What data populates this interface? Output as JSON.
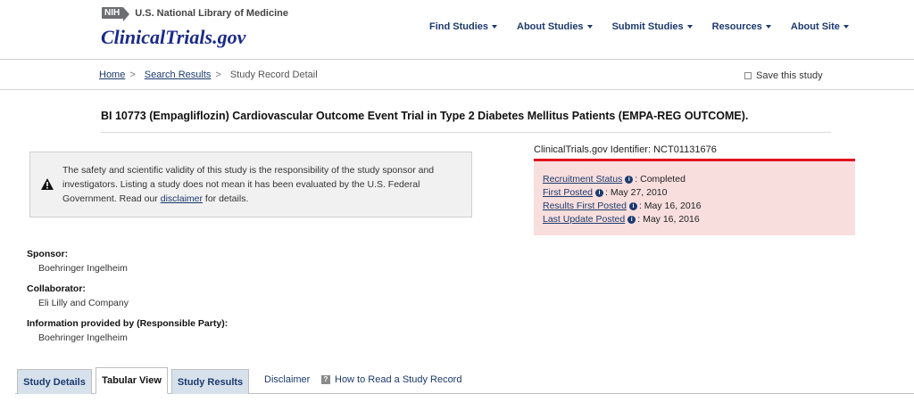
{
  "header": {
    "nih_badge": "NIH",
    "nih_text": "U.S. National Library of Medicine",
    "logo": "ClinicalTrials.gov",
    "nav": [
      {
        "label": "Find Studies"
      },
      {
        "label": "About Studies"
      },
      {
        "label": "Submit Studies"
      },
      {
        "label": "Resources"
      },
      {
        "label": "About Site"
      }
    ]
  },
  "breadcrumb": {
    "home": "Home",
    "search": "Search Results",
    "current": "Study Record Detail",
    "sep": ">"
  },
  "save_label": "Save this study",
  "study_title": "BI 10773 (Empagliflozin) Cardiovascular Outcome Event Trial in Type 2 Diabetes Mellitus Patients (EMPA-REG OUTCOME).",
  "disclaimer": {
    "text_before": "The safety and scientific validity of this study is the responsibility of the study sponsor and investigators. Listing a study does not mean it has been evaluated by the U.S. Federal Government. Read our ",
    "link": "disclaimer",
    "text_after": " for details."
  },
  "identifier": "ClinicalTrials.gov Identifier: NCT01131676",
  "status": [
    {
      "label": "Recruitment Status",
      "value": ": Completed"
    },
    {
      "label": "First Posted",
      "value": ": May 27, 2010"
    },
    {
      "label": "Results First Posted",
      "value": ": May 16, 2016"
    },
    {
      "label": "Last Update Posted",
      "value": ": May 16, 2016"
    }
  ],
  "info_glyph": "i",
  "sponsor": {
    "label": "Sponsor:",
    "value": "Boehringer Ingelheim"
  },
  "collaborator": {
    "label": "Collaborator:",
    "value": "Eli Lilly and Company"
  },
  "responsible": {
    "label": "Information provided by (Responsible Party):",
    "value": "Boehringer Ingelheim"
  },
  "tabs": [
    {
      "label": "Study Details"
    },
    {
      "label": "Tabular View"
    },
    {
      "label": "Study Results"
    }
  ],
  "tab_links": [
    {
      "label": "Disclaimer"
    },
    {
      "label": "How to Read a Study Record"
    }
  ],
  "help_glyph": "?",
  "colors": {
    "brand_navy": "#1b3a6e",
    "alert_red": "#e0141e",
    "status_bg": "#f8dedd",
    "tab_bg": "#d6e1ec"
  }
}
